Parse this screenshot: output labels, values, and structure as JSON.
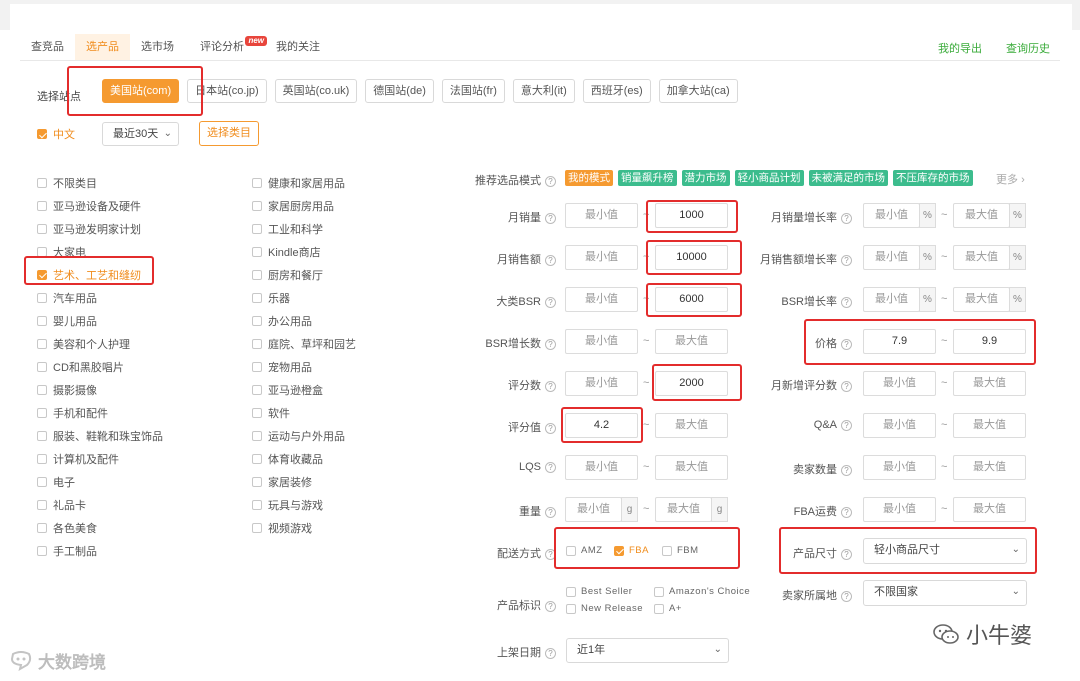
{
  "tabs": [
    {
      "label": "查竞品"
    },
    {
      "label": "选产品"
    },
    {
      "label": "选市场"
    },
    {
      "label": "评论分析",
      "badge": "new"
    },
    {
      "label": "我的关注"
    }
  ],
  "links": {
    "export": "我的导出",
    "history": "查询历史"
  },
  "site_label": "选择站点",
  "sites": [
    "美国站(com)",
    "日本站(co.jp)",
    "英国站(co.uk)",
    "德国站(de)",
    "法国站(fr)",
    "意大利(it)",
    "西班牙(es)",
    "加拿大站(ca)"
  ],
  "language": "中文",
  "period": "最近30天",
  "choose_category": "选择类目",
  "categories_left": [
    "不限类目",
    "亚马逊设备及硬件",
    "亚马逊发明家计划",
    "大家电",
    "艺术、工艺和缝纫",
    "汽车用品",
    "婴儿用品",
    "美容和个人护理",
    "CD和黑胶唱片",
    "摄影摄像",
    "手机和配件",
    "服装、鞋靴和珠宝饰品",
    "计算机及配件",
    "电子",
    "礼品卡",
    "各色美食",
    "手工制品"
  ],
  "categories_right": [
    "健康和家居用品",
    "家居厨房用品",
    "工业和科学",
    "Kindle商店",
    "厨房和餐厅",
    "乐器",
    "办公用品",
    "庭院、草坪和园艺",
    "宠物用品",
    "亚马逊橙盒",
    "软件",
    "运动与户外用品",
    "体育收藏品",
    "家居装修",
    "玩具与游戏",
    "视频游戏"
  ],
  "mode_label": "推荐选品模式",
  "modes": [
    "我的模式",
    "销量飙升榜",
    "潜力市场",
    "轻小商品计划",
    "未被满足的市场",
    "不压库存的市场"
  ],
  "more": "更多",
  "placeholders": {
    "min": "最小值",
    "max": "最大值"
  },
  "filters": {
    "monthly_sales": {
      "label": "月销量",
      "max": "1000"
    },
    "monthly_revenue": {
      "label": "月销售额",
      "max": "10000"
    },
    "bsr": {
      "label": "大类BSR",
      "max": "6000"
    },
    "bsr_growth": {
      "label": "BSR增长数"
    },
    "review_count": {
      "label": "评分数",
      "max": "2000"
    },
    "rating": {
      "label": "评分值",
      "min": "4.2"
    },
    "lqs": {
      "label": "LQS"
    },
    "weight": {
      "label": "重量",
      "unit": "g"
    },
    "sales_growth": {
      "label": "月销量增长率",
      "unit": "%"
    },
    "revenue_growth": {
      "label": "月销售额增长率",
      "unit": "%"
    },
    "bsr_rate": {
      "label": "BSR增长率",
      "unit": "%"
    },
    "price": {
      "label": "价格",
      "min": "7.9",
      "max": "9.9"
    },
    "new_reviews": {
      "label": "月新增评分数"
    },
    "qa": {
      "label": "Q&A"
    },
    "sellers": {
      "label": "卖家数量"
    },
    "fba_fee": {
      "label": "FBA运费"
    }
  },
  "shipping": {
    "label": "配送方式",
    "options": [
      "AMZ",
      "FBA",
      "FBM"
    ]
  },
  "size": {
    "label": "产品尺寸",
    "value": "轻小商品尺寸"
  },
  "badges": {
    "label": "产品标识",
    "options": [
      "Best Seller",
      "Amazon's Choice",
      "New Release",
      "A+"
    ]
  },
  "seller_location": {
    "label": "卖家所属地",
    "value": "不限国家"
  },
  "listing_date": {
    "label": "上架日期",
    "value": "近1年"
  },
  "watermarks": {
    "left": "大数跨境",
    "right": "小牛婆"
  }
}
